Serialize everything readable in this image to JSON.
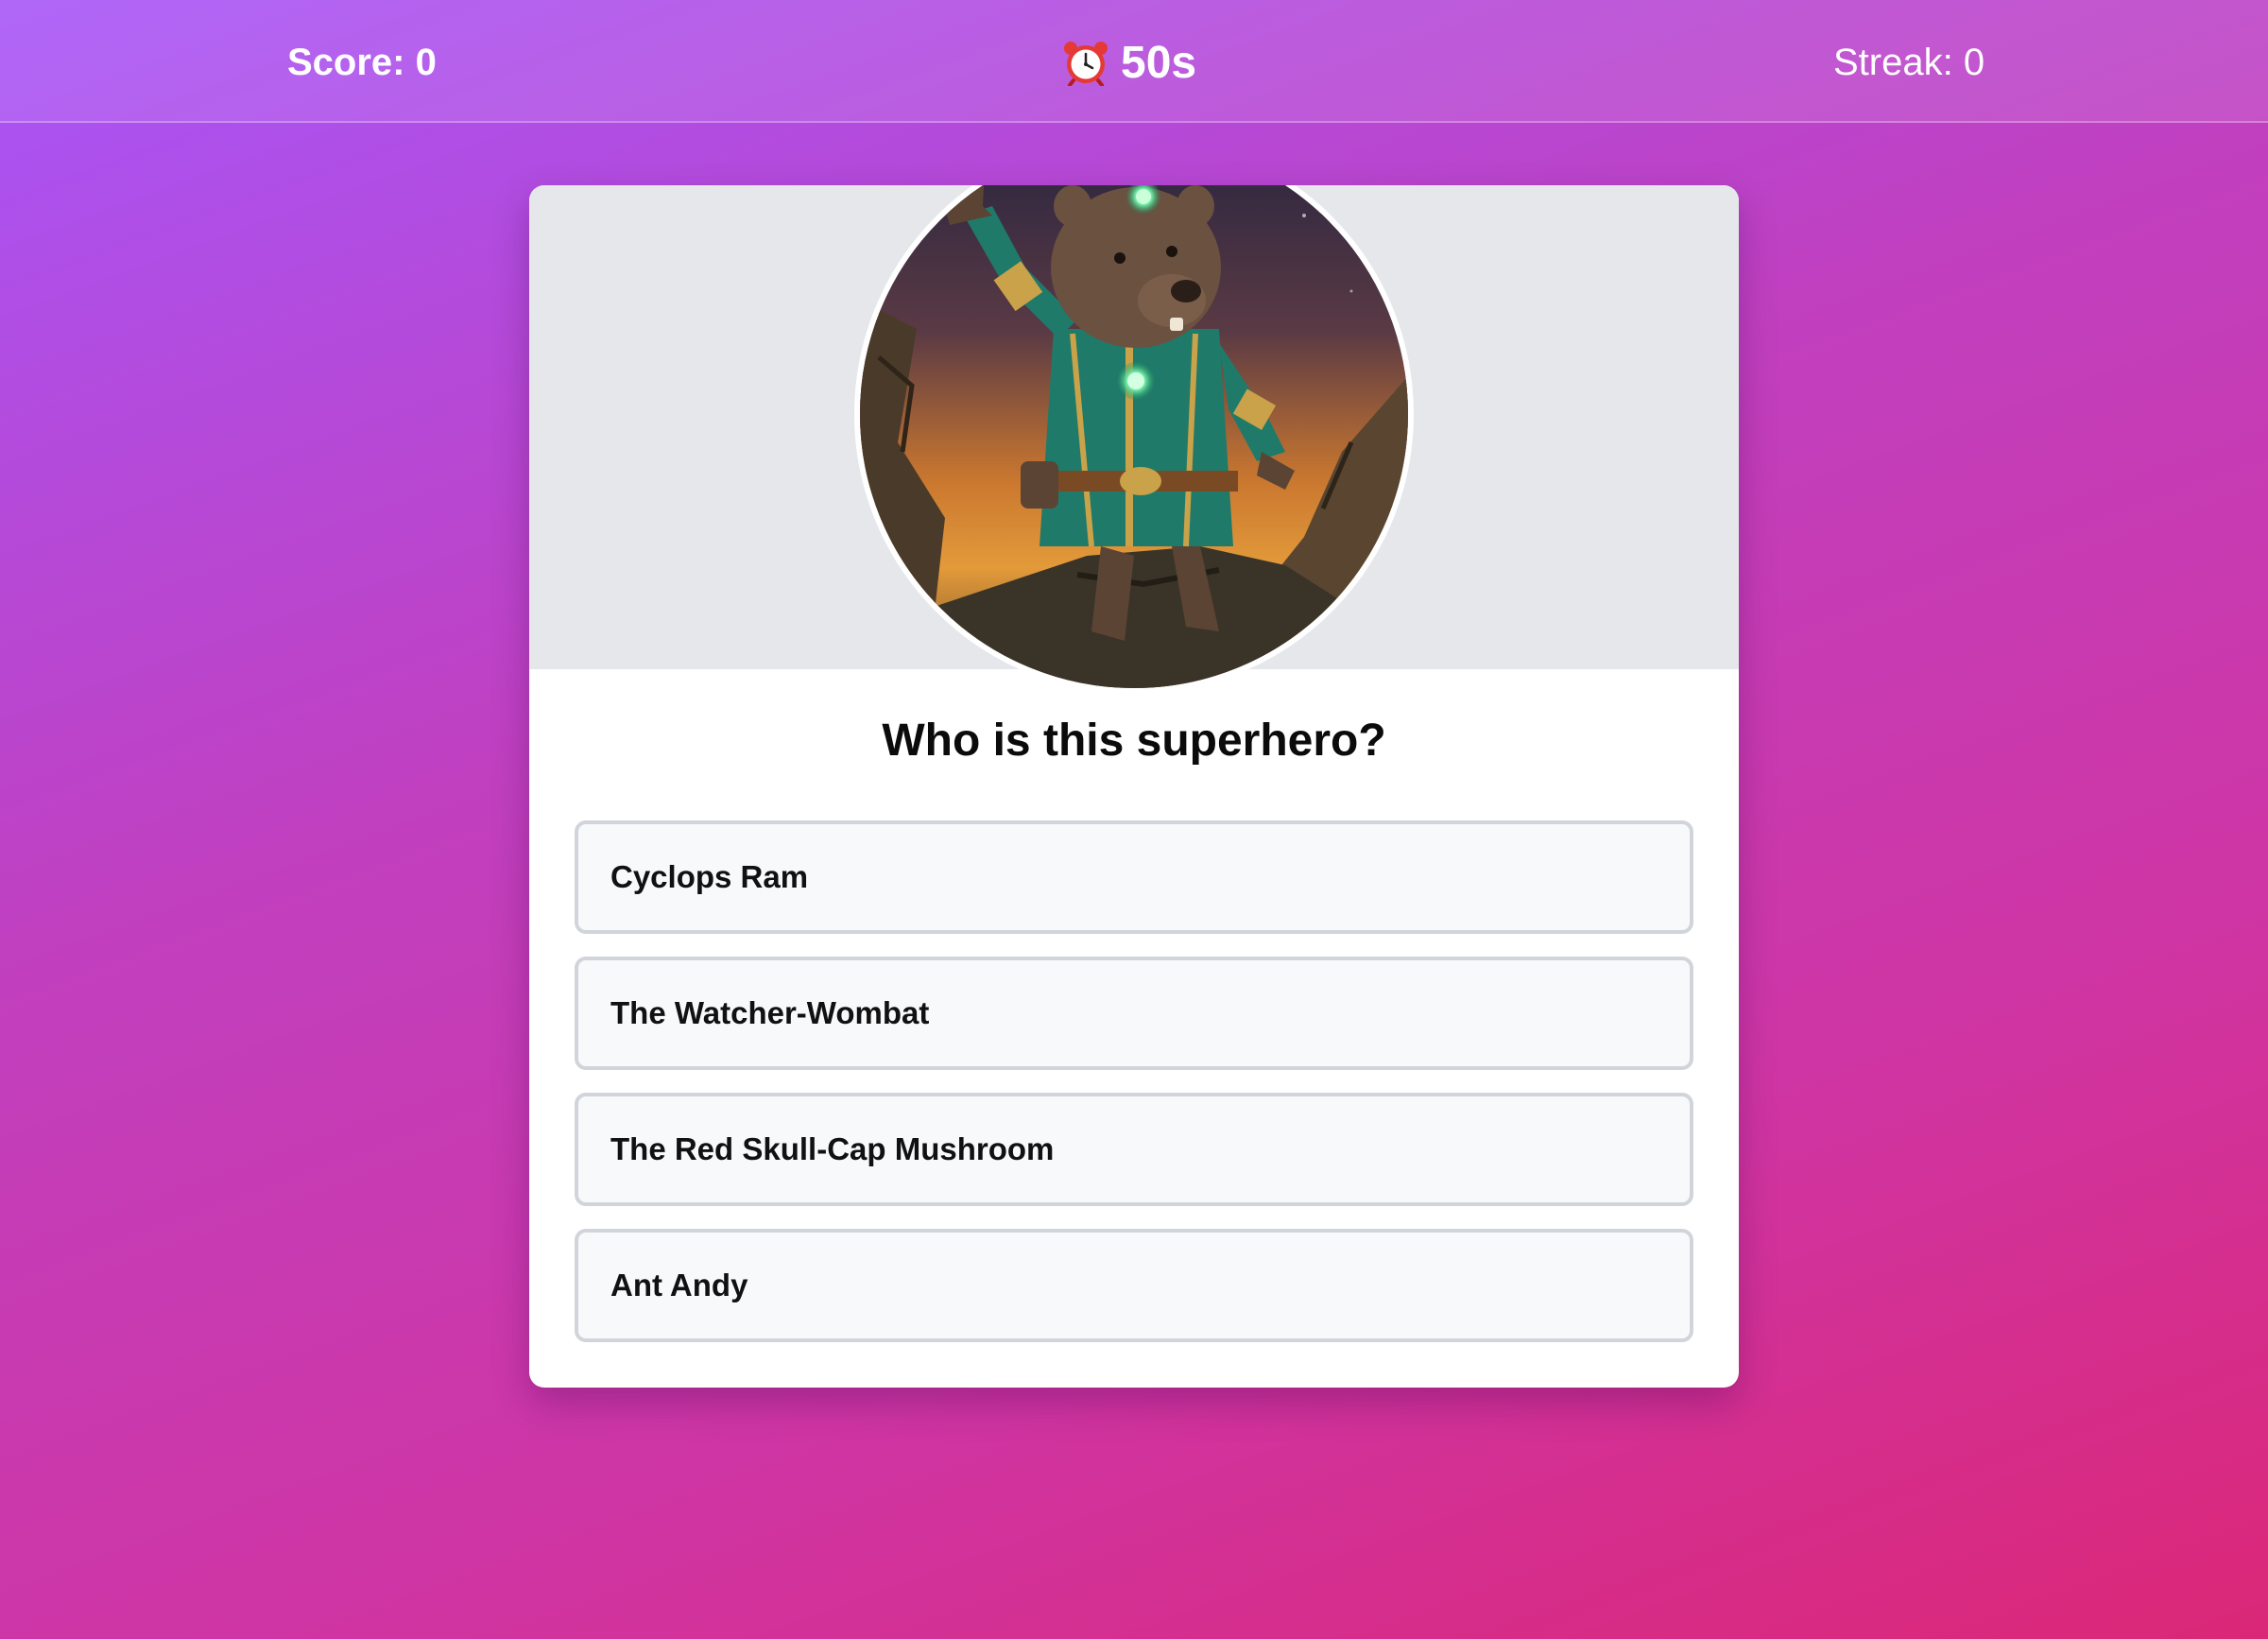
{
  "status_bar": {
    "score_text": "Score: 0",
    "timer_icon": "alarm-clock-icon",
    "timer_text": "50s",
    "streak_text": "Streak: 0"
  },
  "quiz": {
    "image_subject": "superhero-wombat-portrait",
    "question": "Who is this superhero?",
    "options": [
      {
        "label": "Cyclops Ram"
      },
      {
        "label": "The Watcher-Wombat"
      },
      {
        "label": "The Red Skull-Cap Mushroom"
      },
      {
        "label": "Ant Andy"
      }
    ]
  },
  "colors": {
    "background_start": "#a855f7",
    "background_end": "#db2777",
    "card": "#ffffff",
    "card_header": "#e5e7eb",
    "option_bg": "#f8f9fb",
    "option_border": "#d1d5db",
    "suit_green": "#1f7a6a",
    "gem_glow": "#6ee7a3"
  }
}
